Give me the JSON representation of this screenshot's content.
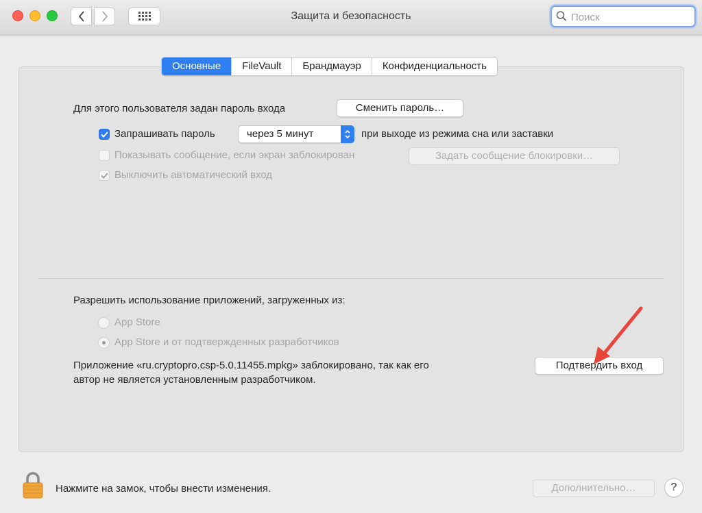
{
  "window": {
    "title": "Защита и безопасность",
    "search_placeholder": "Поиск"
  },
  "tabs": [
    {
      "label": "Основные",
      "active": true
    },
    {
      "label": "FileVault",
      "active": false
    },
    {
      "label": "Брандмауэр",
      "active": false
    },
    {
      "label": "Конфиденциальность",
      "active": false
    }
  ],
  "general": {
    "password_set_label": "Для этого пользователя задан пароль входа",
    "change_password_button": "Сменить пароль…",
    "require_password": {
      "label": "Запрашивать пароль",
      "checked": true
    },
    "delay_value": "через 5 минут",
    "after_sleep_label": "при выходе из режима сна или заставки",
    "show_message": {
      "label": "Показывать сообщение, если экран заблокирован",
      "checked": false,
      "enabled": false
    },
    "set_lock_message_button": "Задать сообщение блокировки…",
    "disable_auto_login": {
      "label": "Выключить автоматический вход",
      "checked": true,
      "enabled": false
    }
  },
  "apps": {
    "allow_label": "Разрешить использование приложений, загруженных из:",
    "options": [
      {
        "label": "App Store",
        "selected": false
      },
      {
        "label": "App Store и от подтвержденных разработчиков",
        "selected": true
      }
    ],
    "blocked_line1": "Приложение «ru.cryptopro.csp-5.0.11455.mpkg» заблокировано, так как его",
    "blocked_line2": "автор не является установленным разработчиком.",
    "open_anyway_button": "Подтвердить вход"
  },
  "footer": {
    "lock_text": "Нажмите на замок, чтобы внести изменения.",
    "advanced_button": "Дополнительно…",
    "help_label": "?"
  },
  "colors": {
    "accent": "#2f7ff1",
    "annotation_arrow": "#e8453c"
  }
}
